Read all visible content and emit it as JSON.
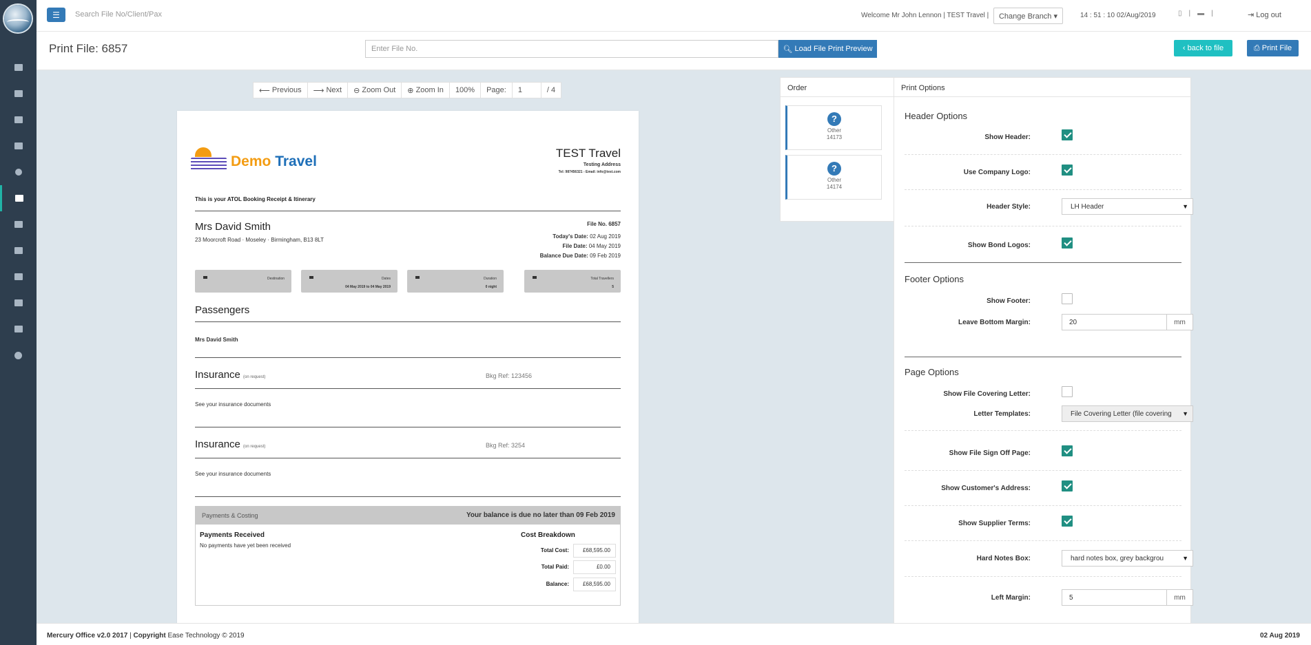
{
  "sidebar": {
    "items": [
      "dashboard",
      "id-card",
      "grid",
      "users",
      "help",
      "copy",
      "calendar",
      "users-group",
      "sitemap",
      "credit-card",
      "laptop",
      "globe"
    ],
    "active_index": 5
  },
  "topbar": {
    "search_placeholder": "Search File No/Client/Pax",
    "welcome": "Welcome Mr John Lennon | TEST Travel |",
    "change_branch": "Change Branch ▾",
    "clock": "14 : 51 : 10    02/Aug/2019",
    "logout": "Log out"
  },
  "header": {
    "title": "Print File: 6857",
    "file_no_placeholder": "Enter File No.",
    "load_btn": "Load File Print Preview",
    "back_btn": "back to file",
    "print_btn": "Print File"
  },
  "pdf_toolbar": {
    "previous": "Previous",
    "next": "Next",
    "zoom_out": "Zoom Out",
    "zoom_in": "Zoom In",
    "zoom": "100%",
    "page_label": "Page:",
    "page": "1",
    "total": "/ 4"
  },
  "document": {
    "brand_a": "Demo ",
    "brand_b": "Travel",
    "company": "TEST Travel",
    "company_address": "Testing Address",
    "company_contact": "Tel: 987456321 - Email: info@test.com",
    "receipt_title": "This is your ATOL Booking Receipt & Itinerary",
    "client_name": "Mrs David Smith",
    "client_address": "23 Moorcroft Road · Moseley · Birmingham, B13 8LT",
    "file_no": "File No. 6857",
    "todays_date_label": "Today's Date:",
    "todays_date": "02 Aug 2019",
    "file_date_label": "File Date:",
    "file_date": "04 May 2019",
    "balance_due_label": "Balance Due Date:",
    "balance_due": "09 Feb 2019",
    "boxes": [
      {
        "label": "Destination",
        "value": ""
      },
      {
        "label": "Dates",
        "value": "04 May 2019 to 04 May 2019"
      },
      {
        "label": "Duration",
        "value": "0 night"
      },
      {
        "label": "Total Travellers",
        "value": "5"
      }
    ],
    "passengers_heading": "Passengers",
    "passenger_1": "Mrs David Smith",
    "insurance_1": {
      "title": "Insurance",
      "note": "(on request)",
      "ref": "Bkg Ref: 123456",
      "text": "See your insurance documents"
    },
    "insurance_2": {
      "title": "Insurance",
      "note": "(on request)",
      "ref": "Bkg Ref: 3254",
      "text": "See your insurance documents"
    },
    "payments_bar_left": "Payments & Costing",
    "payments_bar_right": "Your balance is due no later than 09 Feb 2019",
    "payments_received": "Payments Received",
    "payments_none": "No payments have yet been received",
    "cost_breakdown": "Cost Breakdown",
    "total_cost_label": "Total Cost:",
    "total_cost": "£68,595.00",
    "total_paid_label": "Total Paid:",
    "total_paid": "£0.00",
    "balance_label": "Balance:",
    "balance": "£68,595.00"
  },
  "order": {
    "title": "Order",
    "items": [
      {
        "type": "Other",
        "number": "14173"
      },
      {
        "type": "Other",
        "number": "14174"
      }
    ]
  },
  "print_options": {
    "title": "Print Options",
    "header_options": "Header Options",
    "show_header": "Show Header:",
    "use_company_logo": "Use Company Logo:",
    "header_style": "Header Style:",
    "header_style_value": "LH Header",
    "show_bond_logos": "Show Bond Logos:",
    "footer_options": "Footer Options",
    "show_footer": "Show Footer:",
    "leave_bottom_margin": "Leave Bottom Margin:",
    "bottom_margin_value": "20",
    "unit_mm": "mm",
    "page_options": "Page Options",
    "show_file_covering_letter": "Show File Covering Letter:",
    "letter_templates": "Letter Templates:",
    "letter_templates_value": "File Covering Letter (file covering",
    "show_file_sign_off_page": "Show File Sign Off Page:",
    "show_customers_address": "Show Customer's Address:",
    "show_supplier_terms": "Show Supplier Terms:",
    "hard_notes_box": "Hard Notes Box:",
    "hard_notes_box_value": "hard notes box, grey backgrou",
    "left_margin": "Left Margin:",
    "left_margin_value": "5"
  },
  "footer": {
    "version": "Mercury Office v2.0 2017",
    "copyright_bold": "Copyright",
    "copyright_rest": " Ease Technology © 2019",
    "date": "02 Aug 2019"
  }
}
